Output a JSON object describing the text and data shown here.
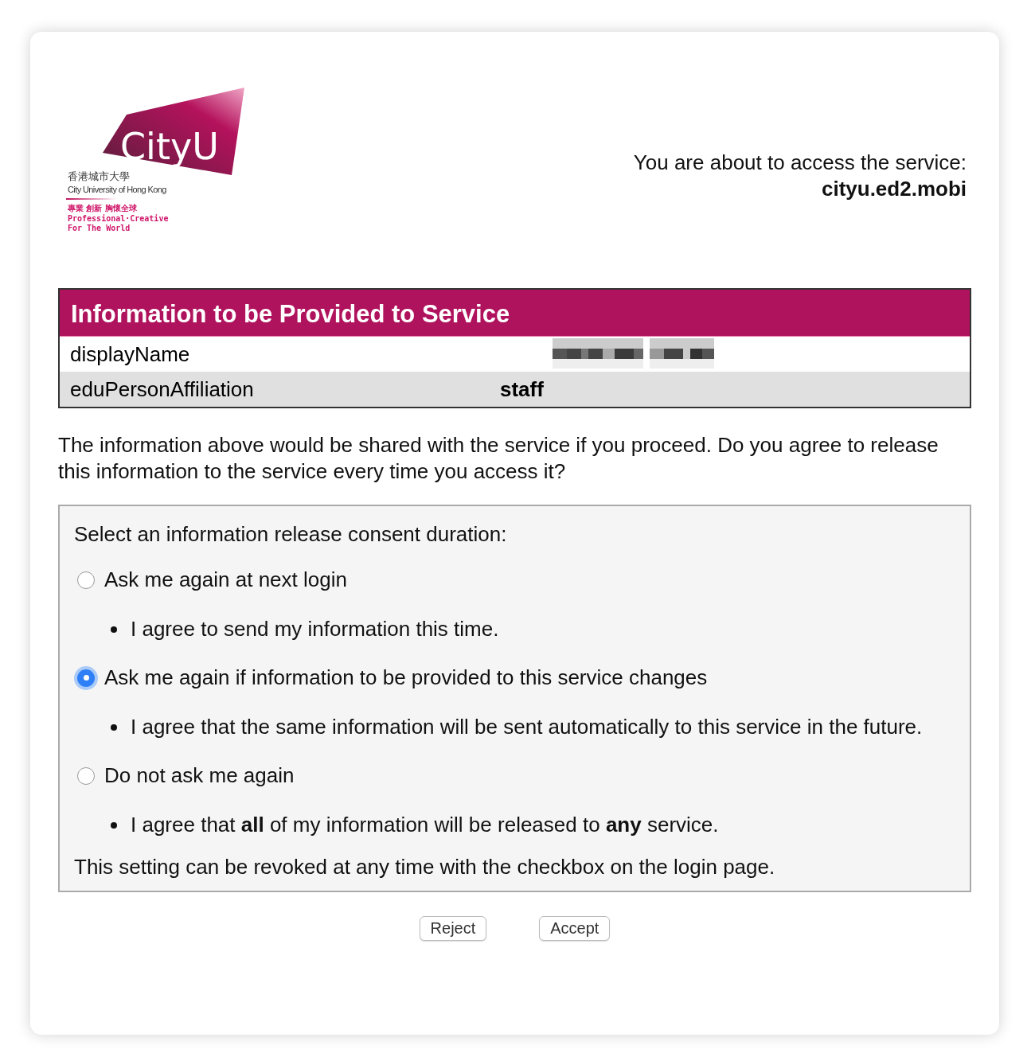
{
  "logo": {
    "wordmark": "CityU",
    "name_zh": "香港城市大學",
    "name_en": "City University of Hong Kong",
    "motto_zh": "專業 創新 胸懷全球",
    "motto_en_1": "Professional·Creative",
    "motto_en_2": "For The World"
  },
  "service": {
    "intro": "You are about to access the service:",
    "name": "cityu.ed2.mobi"
  },
  "attributes": {
    "title": "Information to be Provided to Service",
    "rows": [
      {
        "name": "displayName",
        "kind": "redacted"
      },
      {
        "name": "eduPersonAffiliation",
        "kind": "text",
        "value": "staff"
      }
    ]
  },
  "notice": "The information above would be shared with the service if you proceed. Do you agree to release this information to the service every time you access it?",
  "consent": {
    "prompt": "Select an information release consent duration:",
    "options": [
      {
        "label": "Ask me again at next login",
        "selected": false,
        "details": [
          "I agree to send my information this time."
        ]
      },
      {
        "label": "Ask me again if information to be provided to this service changes",
        "selected": true,
        "details": [
          "I agree that the same information will be sent automatically to this service in the future."
        ]
      },
      {
        "label": "Do not ask me again",
        "selected": false,
        "details": [
          "I agree that **all** of my information will be released to **any** service."
        ]
      }
    ],
    "footnote": "This setting can be revoked at any time with the checkbox on the login page."
  },
  "buttons": [
    "Reject",
    "Accept"
  ]
}
